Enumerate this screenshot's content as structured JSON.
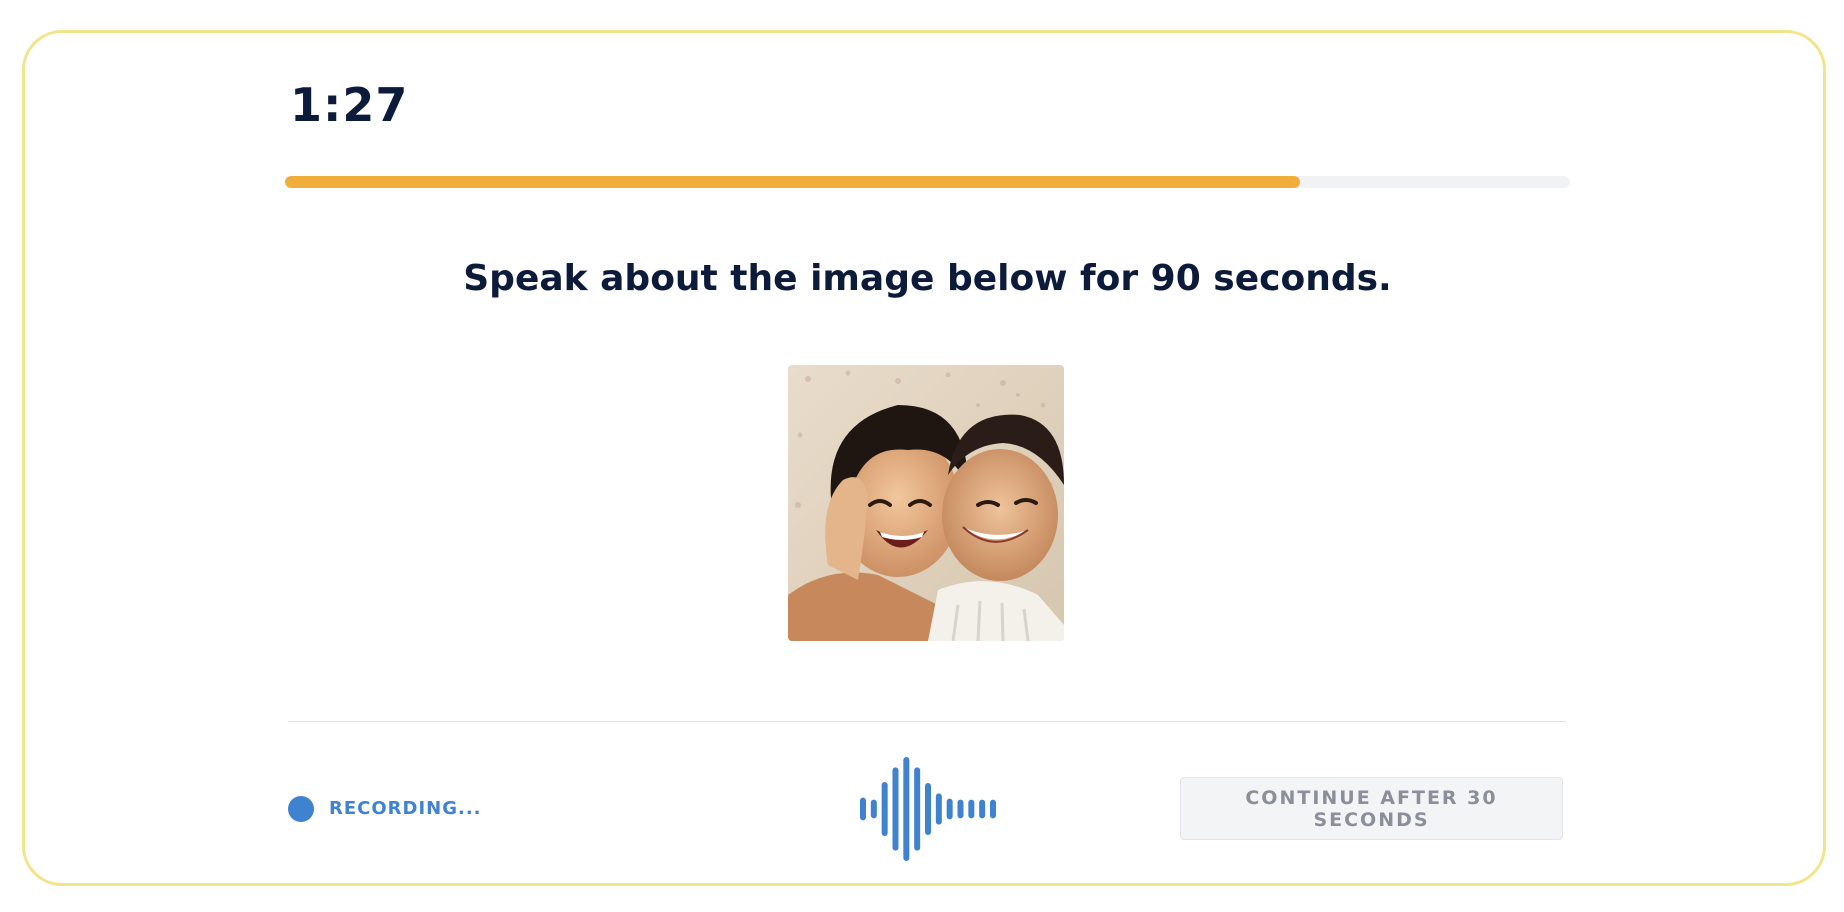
{
  "timer": {
    "text": "1:27"
  },
  "progress": {
    "fraction": 0.79,
    "color": "#f0ad3c"
  },
  "prompt": {
    "text": "Speak about the image below for 90 seconds."
  },
  "recording": {
    "label": "RECORDING...",
    "color": "#3f82d0"
  },
  "waveform": {
    "color": "#3f82d0",
    "levels": [
      0.22,
      0.18,
      0.52,
      0.8,
      1.0,
      0.8,
      0.5,
      0.3,
      0.2,
      0.18,
      0.18,
      0.18,
      0.18
    ]
  },
  "continue_button": {
    "label": "CONTINUE AFTER 30 SECONDS"
  }
}
